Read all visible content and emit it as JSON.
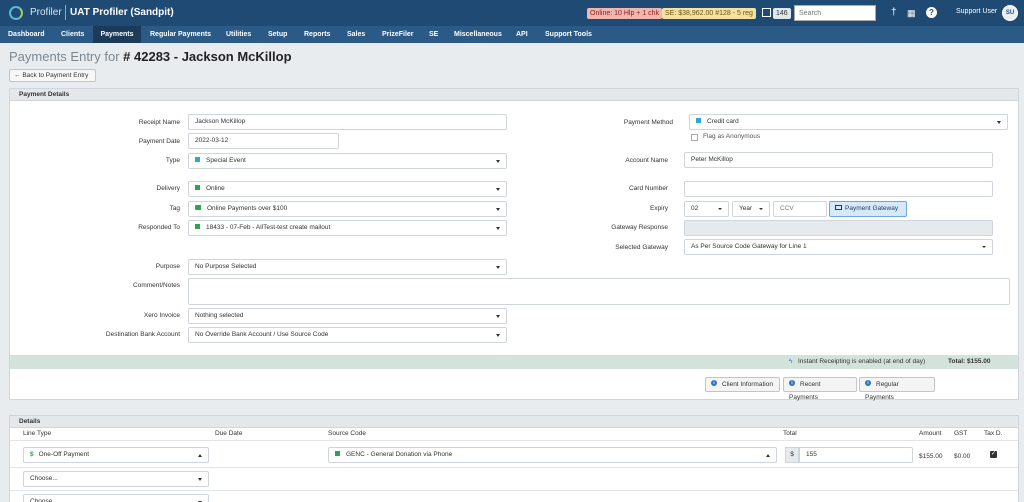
{
  "topbar": {
    "brand": "Profiler",
    "environment": "UAT Profiler (Sandpit)",
    "online_badge": "Online: 10 Hlp + 1 chk",
    "se_badge": "SE: $38,962.00 #128 - 5 reg",
    "count_badge": "146",
    "search_placeholder": "Search",
    "user": "Support User",
    "avatar_initials": "SU",
    "help_icon": "?"
  },
  "menu": [
    "Dashboard",
    "Clients",
    "Payments",
    "Regular Payments",
    "Utilities",
    "Setup",
    "Reports",
    "Sales",
    "PrizeFiler",
    "SE",
    "Miscellaneous",
    "API",
    "Support Tools"
  ],
  "menu_active": "Payments",
  "page": {
    "title_prefix": "Payments Entry for ",
    "title_record": "# 42283 - Jackson McKillop",
    "back_button": "Back to Payment Entry"
  },
  "payment_details": {
    "heading": "Payment Details",
    "labels": {
      "receipt_name": "Receipt Name",
      "payment_date": "Payment Date",
      "type": "Type",
      "delivery": "Delivery",
      "tag": "Tag",
      "responded_to": "Responded To",
      "purpose": "Purpose",
      "comment": "Comment/Notes",
      "xero_invoice": "Xero Invoice",
      "destination_bank": "Destination Bank Account",
      "payment_method": "Payment Method",
      "account_name": "Account Name",
      "card_number": "Card Number",
      "expiry": "Expiry",
      "gateway_response": "Gateway Response",
      "selected_gateway": "Selected Gateway"
    },
    "values": {
      "receipt_name": "Jackson McKillop",
      "payment_date": "2022-03-12",
      "type": "Special Event",
      "delivery": "Online",
      "tag": "Online Payments over $100",
      "responded_to": "18433 - 07-Feb - AllTest-test create mailout",
      "purpose": "No Purpose Selected",
      "comment": "",
      "xero_invoice": "Nothing selected",
      "destination_bank": "No Override Bank Account / Use Source Code",
      "payment_method": "Credit card",
      "flag_anonymous": "Flag as Anonymous",
      "account_name": "Peter McKillop",
      "card_number": "",
      "expiry_month": "02",
      "expiry_year": "Year",
      "ccv_placeholder": "CCV",
      "gateway_button": "Payment Gateway",
      "gateway_response": "",
      "selected_gateway": "As Per Source Code Gateway for Line 1"
    },
    "status": {
      "instant_receipting": "Instant Receipting is enabled (at end of day)",
      "total": "Total: $155.00"
    },
    "buttons": {
      "client_info": "Client Information",
      "recent_payments": "Recent Payments",
      "regular_payments": "Regular Payments"
    }
  },
  "details": {
    "heading": "Details",
    "columns": {
      "line_type": "Line Type",
      "due_date": "Due Date",
      "source_code": "Source Code",
      "total": "Total",
      "amount": "Amount",
      "gst": "GST",
      "tax": "Tax D."
    },
    "row1": {
      "line_type": "One-Off Payment",
      "source_code": "GENC - General Donation via Phone",
      "currency": "$",
      "total": "155",
      "amount": "$155.00",
      "gst": "$0.00",
      "tax_deductible": true
    },
    "row2_line_type": "Choose...",
    "row3_line_type": "Choose..."
  },
  "colors": {
    "topbar": "#1f4a73",
    "menubar": "#2b5a86",
    "active_menu": "#1b3b59",
    "status_bar": "#d3e3dc"
  }
}
